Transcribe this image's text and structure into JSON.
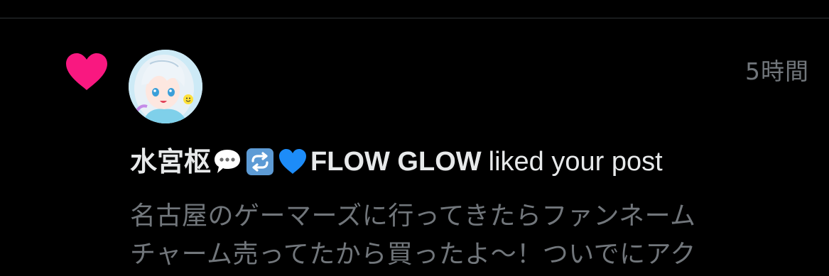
{
  "notification": {
    "timestamp": "5時間",
    "username": "水宮枢",
    "emoji": [
      "speech-balloon",
      "repeat-arrows",
      "blue-heart"
    ],
    "brand": "FLOW GLOW",
    "action": "liked your post",
    "post_lines": [
      "名古屋のゲーマーズに行ってきたらファンネーム",
      "チャーム売ってたから買ったよ〜！ついでにアク"
    ]
  },
  "colors": {
    "like_heart": "#f91880",
    "muted_text": "#71767b",
    "primary_text": "#e7e9ea",
    "background": "#000000",
    "blue_heart": "#1d8cf8"
  }
}
